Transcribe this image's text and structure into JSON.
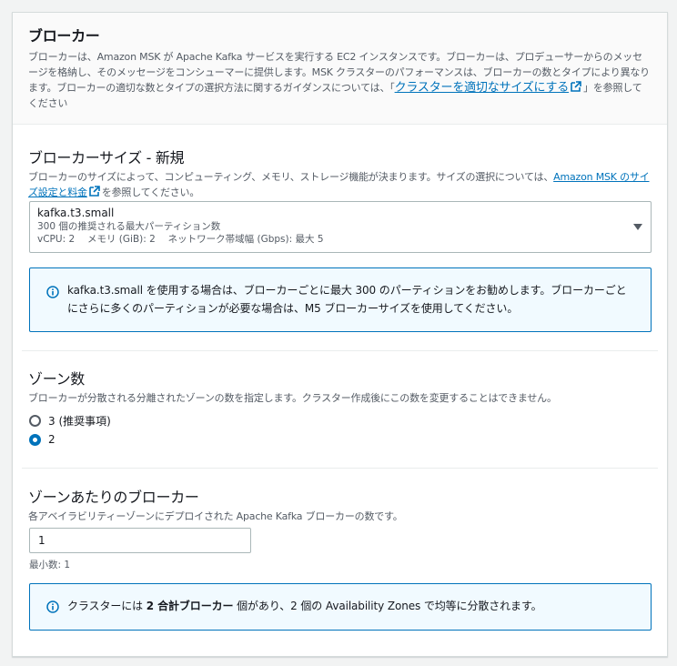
{
  "broker": {
    "title": "ブローカー",
    "desc_part1": "ブローカーは、Amazon MSK が Apache Kafka サービスを実行する EC2 インスタンスです。ブローカーは、プロデューサーからのメッセージを格納し、そのメッセージをコンシューマーに提供します。MSK クラスターのパフォーマンスは、ブローカーの数とタイプにより異なります。ブローカーの適切な数とタイプの選択方法に関するガイダンスについては、「",
    "desc_link": "クラスターを適切なサイズにする",
    "desc_part2": "」を参照してください"
  },
  "broker_size": {
    "title": "ブローカーサイズ - 新規",
    "desc_part1": "ブローカーのサイズによって、コンピューティング、メモリ、ストレージ機能が決まります。サイズの選択については、",
    "desc_link": "Amazon MSK のサイズ設定と料金",
    "desc_part2": "を参照してください。",
    "selected": "kafka.t3.small",
    "selected_sub1": "300 個の推奨される最大パーティション数",
    "selected_sub2": "vCPU: 2　 メモリ (GiB): 2　 ネットワーク帯域幅 (Gbps): 最大 5",
    "info": "kafka.t3.small を使用する場合は、ブローカーごとに最大 300 のパーティションをお勧めします。ブローカーごとにさらに多くのパーティションが必要な場合は、M5 ブローカーサイズを使用してください。"
  },
  "zones": {
    "title": "ゾーン数",
    "desc": "ブローカーが分散される分離されたゾーンの数を指定します。クラスター作成後にこの数を変更することはできません。",
    "options": [
      {
        "label": "3 (推奨事項)",
        "checked": false
      },
      {
        "label": "2",
        "checked": true
      }
    ]
  },
  "brokers_per_zone": {
    "title": "ゾーンあたりのブローカー",
    "desc": "各アベイラビリティーゾーンにデプロイされた Apache Kafka ブローカーの数です。",
    "value": "1",
    "hint": "最小数: 1",
    "info_part1": "クラスターには ",
    "info_bold": "2 合計ブローカー",
    "info_part2": " 個があり、2 個の Availability Zones で均等に分散されます。"
  },
  "colors": {
    "accent": "#0073bb",
    "info_bg": "#f1faff"
  }
}
